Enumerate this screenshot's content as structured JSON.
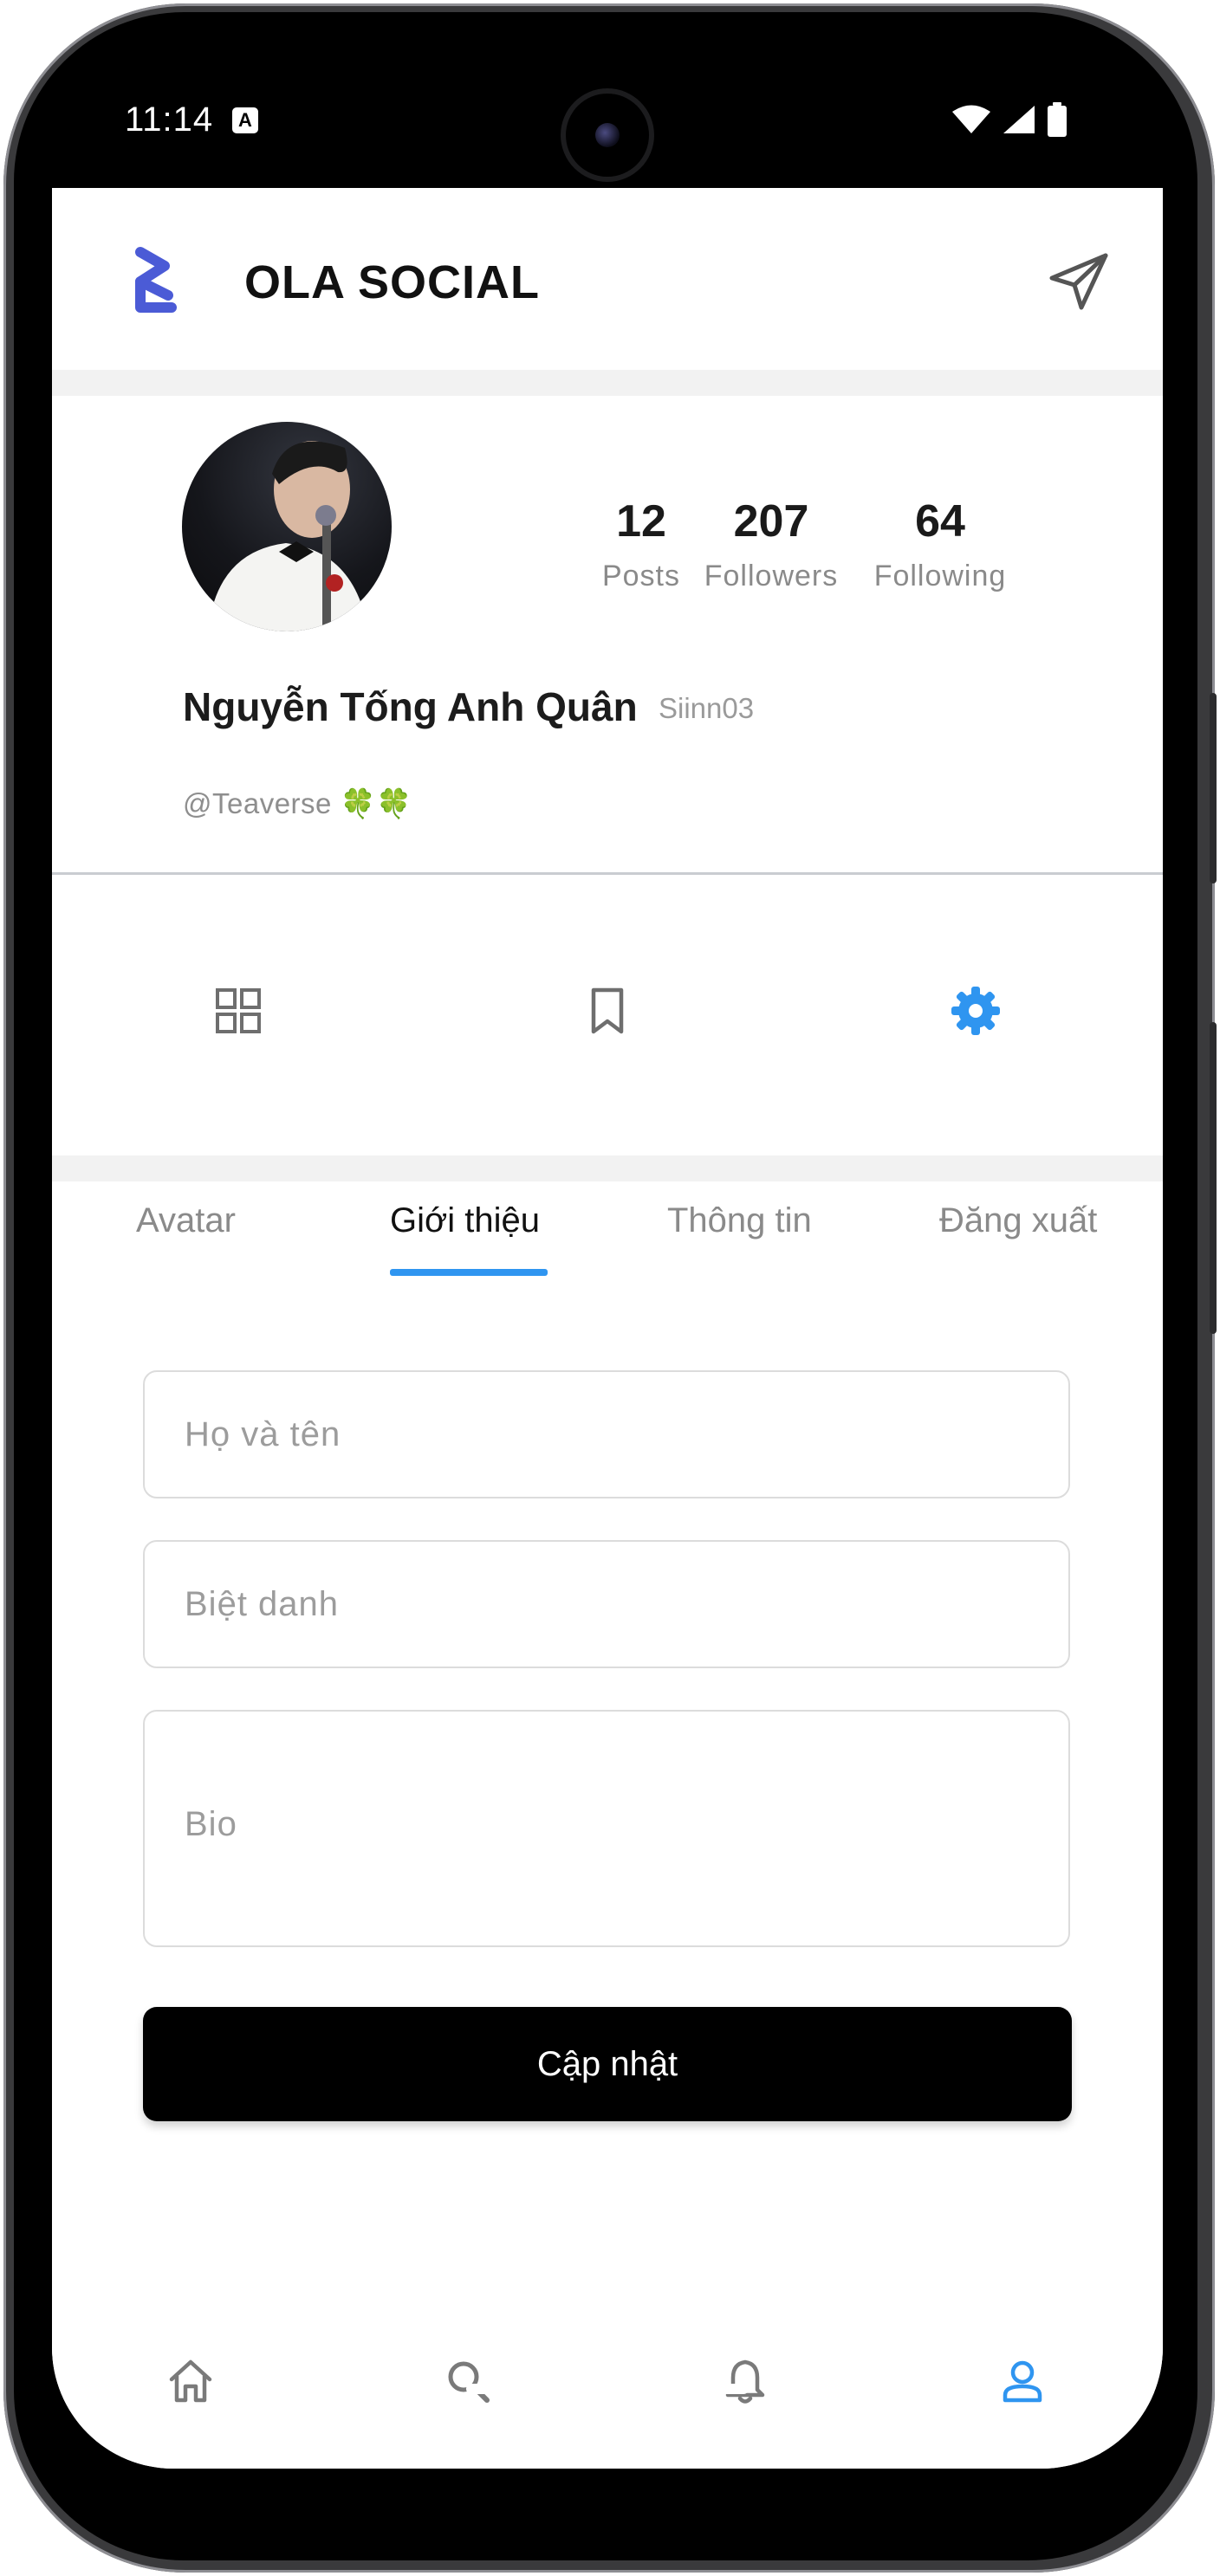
{
  "status_bar": {
    "time": "11:14",
    "notification_glyph": "A"
  },
  "header": {
    "title": "OLA SOCIAL",
    "logo_icon": "ola-logo-icon",
    "action_icon": "send-icon"
  },
  "profile": {
    "full_name": "Nguyễn Tống Anh Quân",
    "nickname": "Siinn03",
    "bio": "@Teaverse 🍀🍀",
    "stats": [
      {
        "value": "12",
        "label": "Posts"
      },
      {
        "value": "207",
        "label": "Followers"
      },
      {
        "value": "64",
        "label": "Following"
      }
    ]
  },
  "icon_tabs": [
    {
      "icon": "grid-icon",
      "active": false
    },
    {
      "icon": "bookmark-icon",
      "active": false
    },
    {
      "icon": "gear-icon",
      "active": true
    }
  ],
  "settings_tabs": [
    {
      "label": "Avatar",
      "active": false
    },
    {
      "label": "Giới thiệu",
      "active": true
    },
    {
      "label": "Thông tin",
      "active": false
    },
    {
      "label": "Đăng xuất",
      "active": false
    }
  ],
  "form": {
    "name_placeholder": "Họ và tên",
    "nickname_placeholder": "Biệt danh",
    "bio_placeholder": "Bio",
    "submit_label": "Cập nhật"
  },
  "bottom_nav": [
    {
      "icon": "home-icon",
      "active": false
    },
    {
      "icon": "search-icon",
      "active": false
    },
    {
      "icon": "bell-icon",
      "active": false
    },
    {
      "icon": "user-icon",
      "active": true
    }
  ],
  "colors": {
    "accent": "#2f95f0",
    "logo": "#4b5bd6",
    "inactive_icon": "#7a7a7a"
  }
}
